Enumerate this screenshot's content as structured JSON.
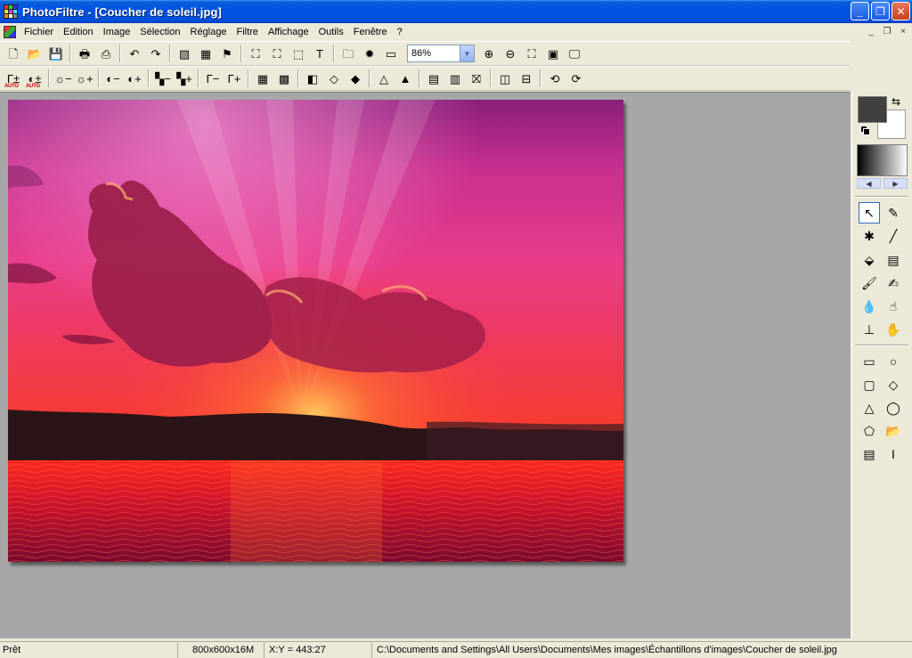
{
  "window": {
    "title": "PhotoFiltre - [Coucher de soleil.jpg]",
    "minimize_symbol": "_",
    "maximize_symbol": "❐",
    "close_symbol": "✕",
    "mdi_minimize_symbol": "_",
    "mdi_restore_symbol": "❐",
    "mdi_close_symbol": "×"
  },
  "menu": {
    "items": [
      "Fichier",
      "Edition",
      "Image",
      "Sélection",
      "Réglage",
      "Filtre",
      "Affichage",
      "Outils",
      "Fenêtre",
      "?"
    ]
  },
  "toolbar1": {
    "buttons": [
      {
        "name": "new-document-icon",
        "glyph": "🗋"
      },
      {
        "name": "open-folder-icon",
        "glyph": "📂"
      },
      {
        "name": "save-disk-icon",
        "glyph": "💾"
      },
      {
        "sep": true
      },
      {
        "name": "print-icon",
        "glyph": "🖶"
      },
      {
        "name": "scan-icon",
        "glyph": "⎙"
      },
      {
        "sep": true
      },
      {
        "name": "undo-icon",
        "glyph": "↶"
      },
      {
        "name": "redo-icon",
        "glyph": "↷"
      },
      {
        "sep": true
      },
      {
        "name": "fill-gray-icon",
        "glyph": "▨"
      },
      {
        "name": "color-grid-icon",
        "glyph": "▦"
      },
      {
        "name": "effect-runner-icon",
        "glyph": "⚑"
      },
      {
        "sep": true
      },
      {
        "name": "image-size-icon",
        "glyph": "⛶"
      },
      {
        "name": "canvas-size-icon",
        "glyph": "⛶"
      },
      {
        "name": "selection-icon",
        "glyph": "⬚"
      },
      {
        "name": "text-icon",
        "glyph": "T"
      },
      {
        "sep": true
      },
      {
        "name": "explorer-icon",
        "glyph": "🗀"
      },
      {
        "name": "plugin-icon",
        "glyph": "✹"
      },
      {
        "name": "window-icon",
        "glyph": "▭"
      }
    ],
    "zoom_value": "86%",
    "zoom_buttons": [
      {
        "name": "zoom-in-icon",
        "glyph": "⊕"
      },
      {
        "name": "zoom-out-icon",
        "glyph": "⊖"
      },
      {
        "name": "fit-window-icon",
        "glyph": "⛶"
      },
      {
        "name": "actual-size-icon",
        "glyph": "▣"
      },
      {
        "name": "fullscreen-icon",
        "glyph": "🖵"
      }
    ]
  },
  "toolbar2": {
    "buttons": [
      {
        "name": "auto-levels-icon",
        "glyph": "Γ±",
        "sub": "AUTO"
      },
      {
        "name": "auto-contrast-icon",
        "glyph": "◐±",
        "sub": "AUTO"
      },
      {
        "sep": true
      },
      {
        "name": "brightness-minus-icon",
        "glyph": "☼−"
      },
      {
        "name": "brightness-plus-icon",
        "glyph": "☼+"
      },
      {
        "sep": true
      },
      {
        "name": "contrast-minus-icon",
        "glyph": "◐−"
      },
      {
        "name": "contrast-plus-icon",
        "glyph": "◐+"
      },
      {
        "sep": true
      },
      {
        "name": "saturation-minus-icon",
        "glyph": "▚−"
      },
      {
        "name": "saturation-plus-icon",
        "glyph": "▚+"
      },
      {
        "sep": true
      },
      {
        "name": "gamma-minus-icon",
        "glyph": "Γ−"
      },
      {
        "name": "gamma-plus-icon",
        "glyph": "Γ+"
      },
      {
        "sep": true
      },
      {
        "name": "pixelate-icon",
        "glyph": "▦"
      },
      {
        "name": "mosaic-icon",
        "glyph": "▩"
      },
      {
        "sep": true
      },
      {
        "name": "grayscale-icon",
        "glyph": "◧"
      },
      {
        "name": "blur-icon",
        "glyph": "◇"
      },
      {
        "name": "blur-more-icon",
        "glyph": "◆"
      },
      {
        "sep": true
      },
      {
        "name": "sharpen-icon",
        "glyph": "△"
      },
      {
        "name": "sharpen-more-icon",
        "glyph": "▲"
      },
      {
        "sep": true
      },
      {
        "name": "gradient-fill-icon",
        "glyph": "▤"
      },
      {
        "name": "color-balance-icon",
        "glyph": "▥"
      },
      {
        "name": "frame-icon",
        "glyph": "⛝"
      },
      {
        "sep": true
      },
      {
        "name": "mirror-icon",
        "glyph": "◫"
      },
      {
        "name": "flip-icon",
        "glyph": "⊟"
      },
      {
        "sep": true
      },
      {
        "name": "rotate-left-icon",
        "glyph": "⟲"
      },
      {
        "name": "rotate-right-icon",
        "glyph": "⟳"
      }
    ]
  },
  "colors": {
    "foreground": "#404040",
    "background": "#ffffff",
    "workspace_bg": "#a7a7a7"
  },
  "palette": {
    "swap_glyph": "⇆",
    "nav_left": "◀",
    "nav_right": "▶",
    "tools": [
      {
        "name": "pointer-tool-icon",
        "glyph": "↖",
        "active": true
      },
      {
        "name": "eyedropper-tool-icon",
        "glyph": "✎"
      },
      {
        "name": "magic-wand-tool-icon",
        "glyph": "✱"
      },
      {
        "name": "line-tool-icon",
        "glyph": "╱"
      },
      {
        "name": "fill-bucket-tool-icon",
        "glyph": "⬙"
      },
      {
        "name": "spray-tool-icon",
        "glyph": "▤"
      },
      {
        "name": "brush-tool-icon",
        "glyph": "🖌"
      },
      {
        "name": "advanced-brush-tool-icon",
        "glyph": "✍"
      },
      {
        "name": "blur-drop-tool-icon",
        "glyph": "💧"
      },
      {
        "name": "smudge-tool-icon",
        "glyph": "☝"
      },
      {
        "name": "clone-stamp-tool-icon",
        "glyph": "⊥"
      },
      {
        "name": "hand-tool-icon",
        "glyph": "✋"
      },
      {
        "name": "rectangle-shape-icon",
        "glyph": "▭"
      },
      {
        "name": "ellipse-shape-icon",
        "glyph": "○"
      },
      {
        "name": "rounded-rect-shape-icon",
        "glyph": "▢"
      },
      {
        "name": "diamond-shape-icon",
        "glyph": "◇"
      },
      {
        "name": "triangle-shape-icon",
        "glyph": "△"
      },
      {
        "name": "lasso-shape-icon",
        "glyph": "◯"
      },
      {
        "name": "polygon-shape-icon",
        "glyph": "⬠"
      },
      {
        "name": "open-shape-icon",
        "glyph": "📂"
      },
      {
        "name": "selection-options-icon",
        "glyph": "▤"
      },
      {
        "name": "text-cursor-icon",
        "glyph": "I"
      }
    ]
  },
  "status": {
    "state": "Prêt",
    "image_info": "800x600x16M",
    "coords": "X:Y = 443:27",
    "path": "C:\\Documents and Settings\\All Users\\Documents\\Mes images\\Échantillons d'images\\Coucher de soleil.jpg"
  }
}
